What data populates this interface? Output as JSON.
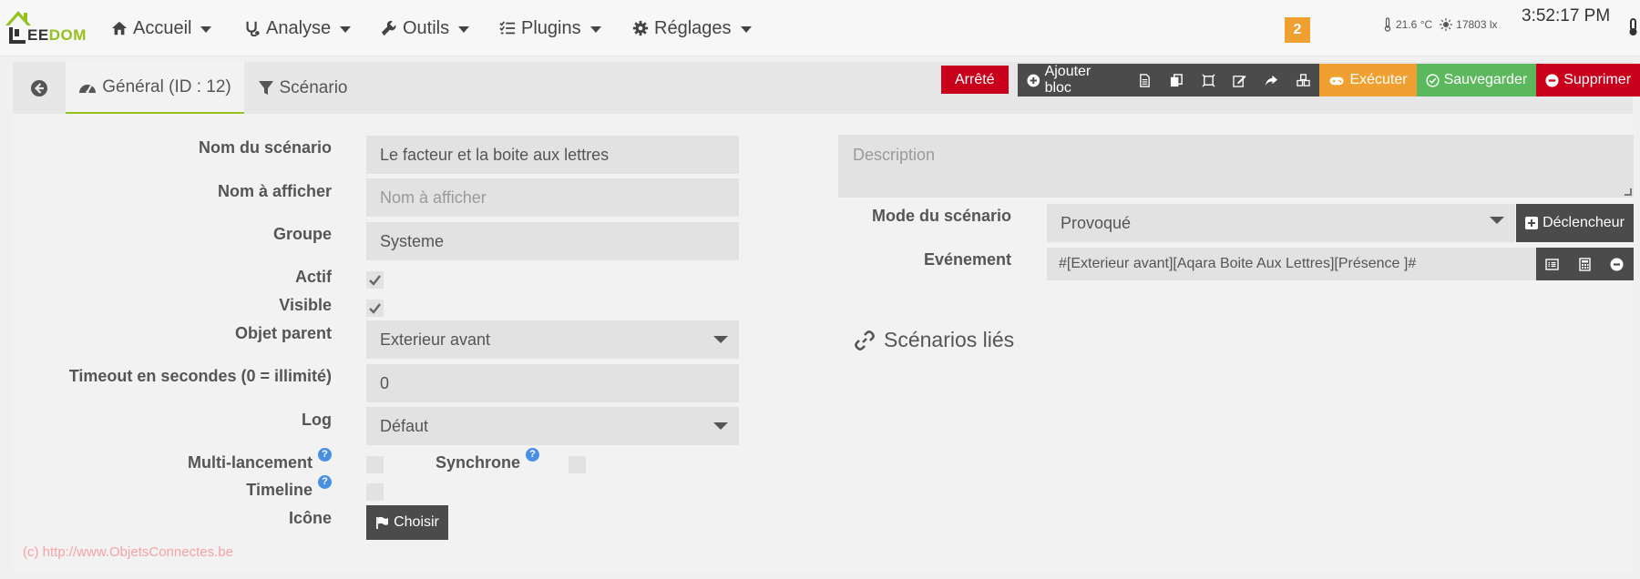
{
  "brand": {
    "logo_text": "EEDOM",
    "accent_color": "#94c11e"
  },
  "nav": {
    "items": [
      {
        "label": "Accueil",
        "icon": "home-icon"
      },
      {
        "label": "Analyse",
        "icon": "stethoscope-icon"
      },
      {
        "label": "Outils",
        "icon": "wrench-icon"
      },
      {
        "label": "Plugins",
        "icon": "tasks-icon"
      },
      {
        "label": "Réglages",
        "icon": "gear-icon"
      }
    ],
    "notification_count": "2",
    "temperature": "21.6 °C",
    "luminosity": "17803 lx",
    "clock": "3:52:17 PM"
  },
  "tabs": {
    "back_icon": "arrow-circle-left-icon",
    "general": "Général (ID : 12)",
    "scenario": "Scénario"
  },
  "toolbar": {
    "status": "Arrêté",
    "add_block": "Ajouter bloc",
    "execute": "Exécuter",
    "save": "Sauvegarder",
    "delete": "Supprimer",
    "colors": {
      "stopped": "#c9001c",
      "execute": "#f0a030",
      "save": "#5cb85c",
      "delete": "#c9001c",
      "dark": "#4b4b4b"
    }
  },
  "form": {
    "name_label": "Nom du scénario",
    "name_value": "Le facteur et la boite aux lettres",
    "display_name_label": "Nom à afficher",
    "display_name_placeholder": "Nom à afficher",
    "group_label": "Groupe",
    "group_value": "Systeme",
    "active_label": "Actif",
    "active_checked": true,
    "visible_label": "Visible",
    "visible_checked": true,
    "parent_label": "Objet parent",
    "parent_value": "Exterieur avant",
    "timeout_label": "Timeout en secondes (0 = illimité)",
    "timeout_value": "0",
    "log_label": "Log",
    "log_value": "Défaut",
    "multi_label": "Multi-lancement",
    "sync_label": "Synchrone",
    "timeline_label": "Timeline",
    "icon_label": "Icône",
    "choose_button": "Choisir",
    "help_glyph": "?"
  },
  "right": {
    "description_placeholder": "Description",
    "mode_label": "Mode du scénario",
    "mode_value": "Provoqué",
    "trigger_button": "Déclencheur",
    "event_label": "Evénement",
    "event_value": "#[Exterieur avant][Aqara Boite Aux Lettres][Présence ]#",
    "linked_title": "Scénarios liés"
  },
  "watermark": "(c) http://www.ObjetsConnectes.be"
}
